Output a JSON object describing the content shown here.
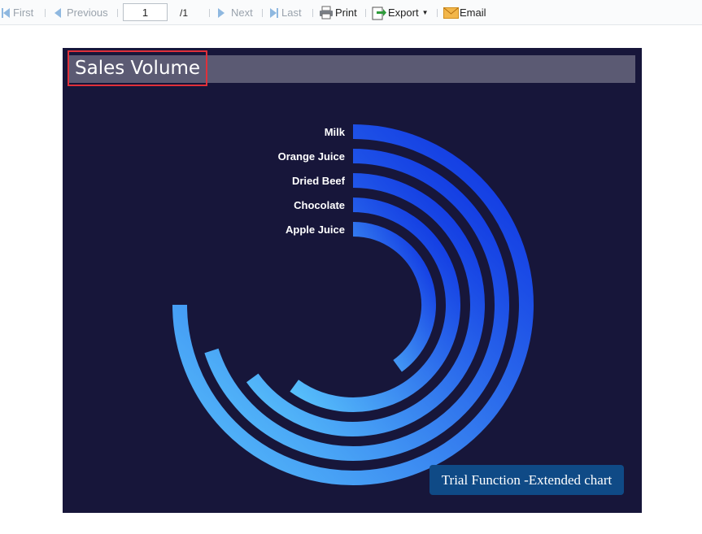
{
  "toolbar": {
    "first": "First",
    "previous": "Previous",
    "page_value": "1",
    "page_total": "/1",
    "next": "Next",
    "last": "Last",
    "print": "Print",
    "export": "Export",
    "email": "Email"
  },
  "report": {
    "title": "Sales Volume",
    "trial_text": "Trial Function -Extended chart"
  },
  "colors": {
    "report_bg": "#17163a",
    "title_bar": "#5b5a73",
    "ring_start": "#0a2be0",
    "ring_end": "#59c3fb",
    "trial_bg": "#0f4a86"
  },
  "chart_data": {
    "type": "radial-bar",
    "title": "Sales Volume",
    "categories": [
      "Milk",
      "Orange Juice",
      "Dried Beef",
      "Chocolate",
      "Apple Juice"
    ],
    "values": [
      75,
      70,
      65,
      60,
      40
    ],
    "max": 100
  }
}
